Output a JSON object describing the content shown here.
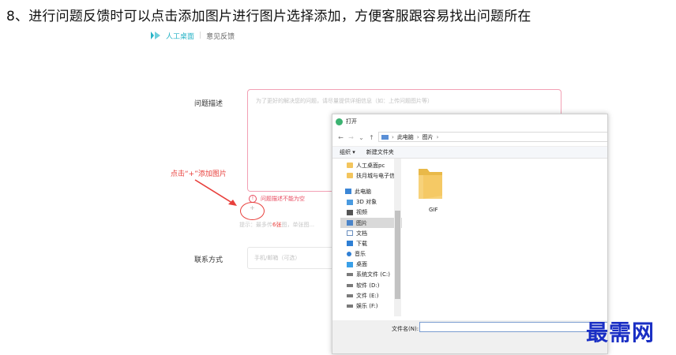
{
  "step_title": "8、进行问题反馈时可以点击添加图片进行图片选择添加，方便客服跟容易找出问题所在",
  "app": {
    "name": "人工桌面",
    "page": "意见反馈",
    "separator": "|",
    "brand_color": "#27b3c6"
  },
  "form": {
    "desc_label": "问题描述",
    "desc_placeholder": "为了更好的解决您的问题，请尽量提供详细信息（如：上传问题图片等）",
    "error_icon": "!",
    "error_text": "问题描述不能为空",
    "add_icon": "+",
    "hint_prefix": "提示：最多传",
    "hint_count": "6张",
    "hint_suffix": "图，单张图...",
    "contact_label": "联系方式",
    "contact_placeholder": "手机/邮箱（可选）"
  },
  "annotation": {
    "text": "点击“+”添加图片",
    "color": "#e8403c"
  },
  "dialog": {
    "title": "打开",
    "nav": {
      "back": "←",
      "forward": "→",
      "dropdown": "⌄",
      "up": "↑"
    },
    "address": {
      "sep1": "›",
      "crumb1": "此电脑",
      "sep2": "›",
      "crumb2": "图片",
      "sep3": "›"
    },
    "toolbar": {
      "organize": "组织 ▾",
      "new_folder": "新建文件夹"
    },
    "sidebar": [
      {
        "label": "人工桌面pc",
        "icon": "folder-icon"
      },
      {
        "label": "扶月城与电子信",
        "icon": "folder-icon"
      },
      {
        "label": "此电脑",
        "icon": "computer-icon"
      },
      {
        "label": "3D 对象",
        "icon": "cube-icon"
      },
      {
        "label": "视频",
        "icon": "video-icon"
      },
      {
        "label": "图片",
        "icon": "picture-icon",
        "selected": true
      },
      {
        "label": "文档",
        "icon": "document-icon"
      },
      {
        "label": "下载",
        "icon": "download-icon"
      },
      {
        "label": "音乐",
        "icon": "music-icon"
      },
      {
        "label": "桌面",
        "icon": "desktop-icon"
      },
      {
        "label": "系统文件 (C:)",
        "icon": "drive-icon"
      },
      {
        "label": "软件 (D:)",
        "icon": "drive-icon"
      },
      {
        "label": "文件 (E:)",
        "icon": "drive-icon"
      },
      {
        "label": "娱乐 (F:)",
        "icon": "drive-icon"
      }
    ],
    "content": {
      "folder_name": "GIF"
    },
    "filename_label": "文件名(N):"
  },
  "watermark": "最需网"
}
